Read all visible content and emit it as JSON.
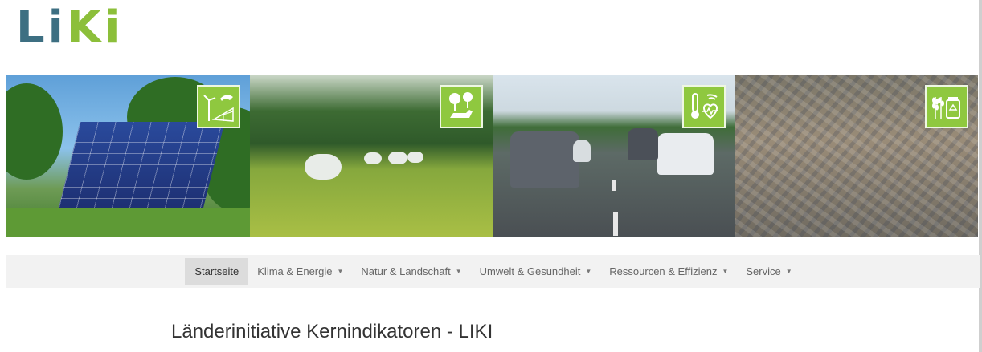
{
  "logo": {
    "part1": "Li",
    "part2": "Ki"
  },
  "banner": {
    "panels": [
      {
        "theme": "klima-energie",
        "icon": "wind-solar-icon"
      },
      {
        "theme": "natur-landschaft",
        "icon": "tree-fox-icon"
      },
      {
        "theme": "umwelt-gesundheit",
        "icon": "thermometer-heart-icon"
      },
      {
        "theme": "ressourcen-effizienz",
        "icon": "grain-recycle-icon"
      }
    ]
  },
  "nav": {
    "items": [
      {
        "label": "Startseite",
        "active": true,
        "dropdown": false
      },
      {
        "label": "Klima & Energie",
        "active": false,
        "dropdown": true
      },
      {
        "label": "Natur & Landschaft",
        "active": false,
        "dropdown": true
      },
      {
        "label": "Umwelt & Gesundheit",
        "active": false,
        "dropdown": true
      },
      {
        "label": "Ressourcen & Effizienz",
        "active": false,
        "dropdown": true
      },
      {
        "label": "Service",
        "active": false,
        "dropdown": true
      }
    ]
  },
  "page": {
    "title": "Länderinitiative Kernindikatoren - LIKI"
  },
  "colors": {
    "logo_dark": "#3d6f82",
    "logo_green": "#8cbf3a",
    "badge_green": "#8fc83f",
    "nav_bg": "#f2f2f2"
  }
}
